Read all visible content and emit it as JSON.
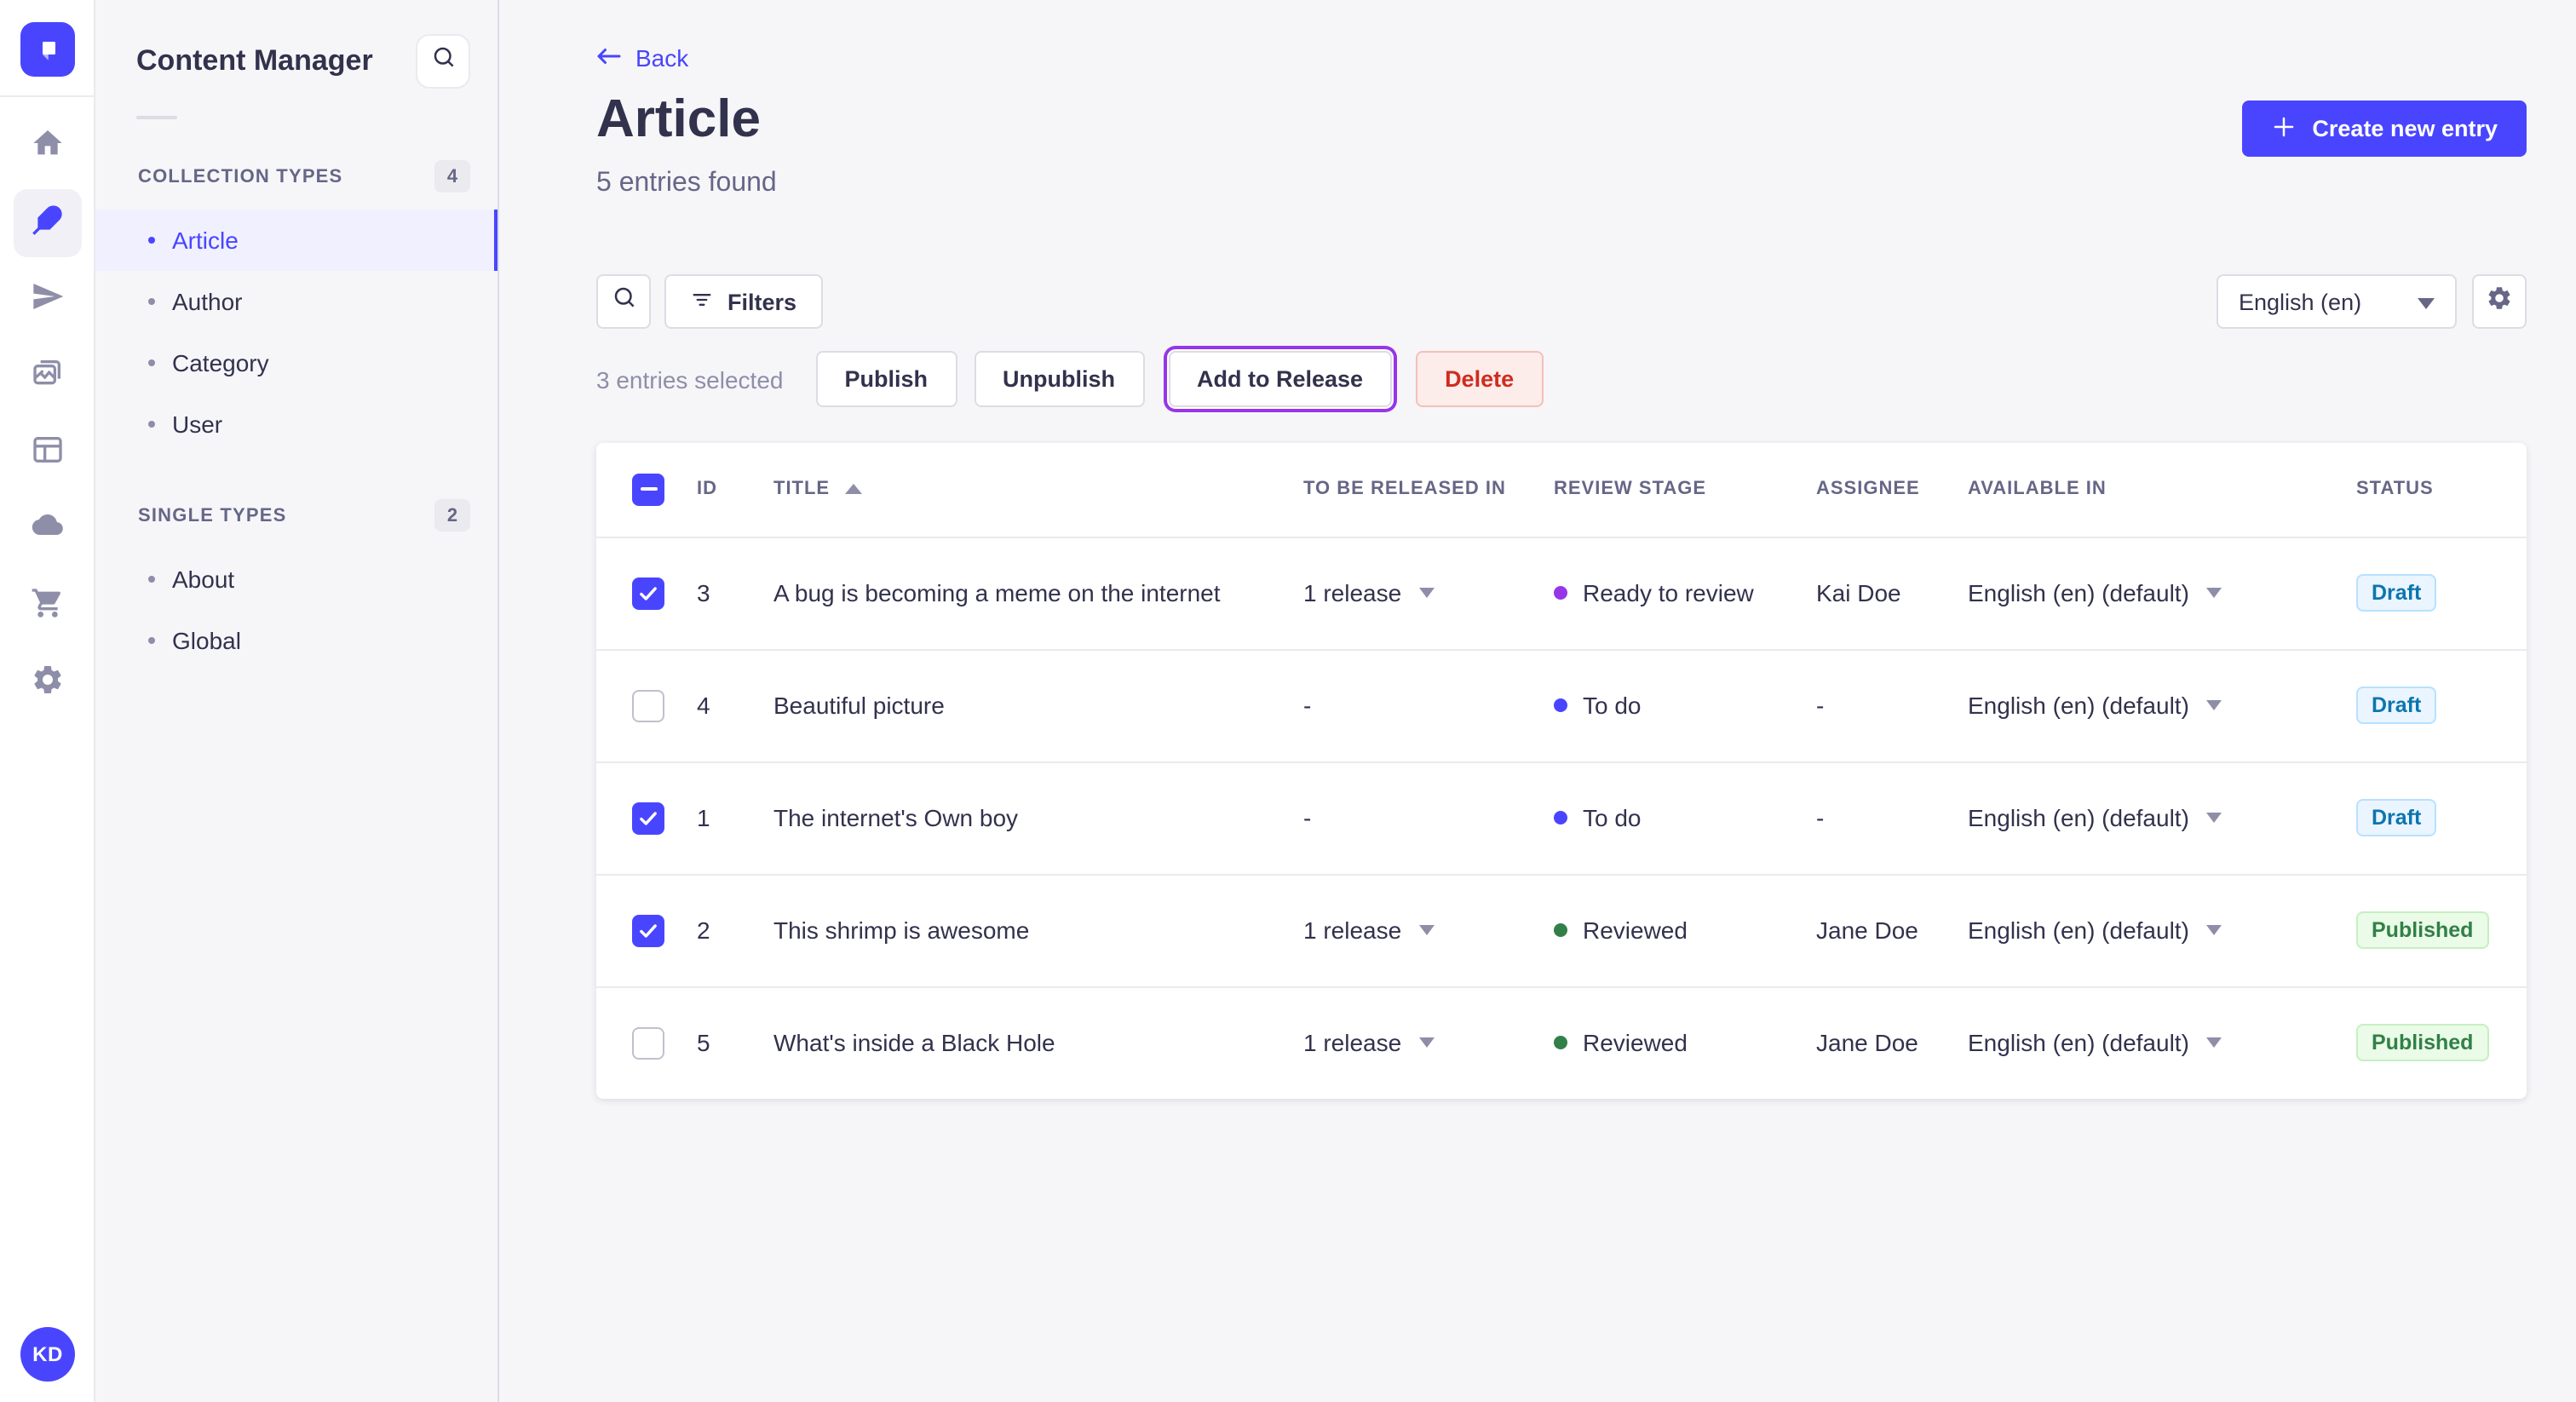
{
  "colors": {
    "primary": "#4945ff",
    "release_focus_ring": "#9736e8",
    "danger_text": "#d02b20",
    "draft_text": "#0c75af",
    "published_text": "#328048"
  },
  "icons": {
    "strapi-logo-icon": "white folded square on indigo",
    "home-icon": "house",
    "feather-icon": "quill pen (content manager, active)",
    "paper-plane-icon": "send / releases",
    "media-library-icon": "stacked photos",
    "layout-icon": "content-type builder panels",
    "cloud-icon": "cloud deploy",
    "cart-icon": "marketplace cart",
    "gear-icon": "settings cog",
    "search-icon": "magnifier",
    "filter-icon": "three funnel lines",
    "chevron-down-icon": "▼",
    "arrow-left-icon": "←",
    "plus-icon": "+",
    "sort-asc-icon": "▲",
    "help-icon": "? in circle"
  },
  "nav": {
    "avatar_initials": "KD",
    "items": [
      {
        "name": "home",
        "active": false
      },
      {
        "name": "content-manager",
        "active": true
      },
      {
        "name": "releases",
        "active": false
      },
      {
        "name": "media-library",
        "active": false
      },
      {
        "name": "content-type-builder",
        "active": false
      },
      {
        "name": "deploy",
        "active": false
      },
      {
        "name": "marketplace",
        "active": false
      },
      {
        "name": "settings",
        "active": false
      }
    ]
  },
  "subnav": {
    "title": "Content Manager",
    "sections": [
      {
        "label": "COLLECTION TYPES",
        "count": "4",
        "items": [
          {
            "label": "Article",
            "active": true
          },
          {
            "label": "Author",
            "active": false
          },
          {
            "label": "Category",
            "active": false
          },
          {
            "label": "User",
            "active": false
          }
        ]
      },
      {
        "label": "SINGLE TYPES",
        "count": "2",
        "items": [
          {
            "label": "About",
            "active": false
          },
          {
            "label": "Global",
            "active": false
          }
        ]
      }
    ]
  },
  "header": {
    "back_label": "Back",
    "title": "Article",
    "subtitle": "5 entries found",
    "create_button_label": "Create new entry"
  },
  "toolbar": {
    "filters_label": "Filters",
    "locale_selected": "English (en)"
  },
  "selection_bar": {
    "selected_text": "3 entries selected",
    "publish_label": "Publish",
    "unpublish_label": "Unpublish",
    "add_to_release_label": "Add to Release",
    "delete_label": "Delete"
  },
  "table": {
    "select_all_state": "indeterminate",
    "columns": [
      {
        "label": "ID",
        "sorted": false
      },
      {
        "label": "TITLE",
        "sorted": "asc"
      },
      {
        "label": "TO BE RELEASED IN",
        "sorted": false
      },
      {
        "label": "REVIEW STAGE",
        "sorted": false
      },
      {
        "label": "ASSIGNEE",
        "sorted": false
      },
      {
        "label": "AVAILABLE IN",
        "sorted": false
      },
      {
        "label": "STATUS",
        "sorted": false
      }
    ],
    "rows": [
      {
        "checked": true,
        "id": "3",
        "title": "A bug is becoming a meme on the internet",
        "release": "1 release",
        "stage": "Ready to review",
        "stage_color": "#9736e8",
        "assignee": "Kai Doe",
        "available": "English (en) (default)",
        "status": "Draft"
      },
      {
        "checked": false,
        "id": "4",
        "title": "Beautiful picture",
        "release": "-",
        "stage": "To do",
        "stage_color": "#4945ff",
        "assignee": "-",
        "available": "English (en) (default)",
        "status": "Draft"
      },
      {
        "checked": true,
        "id": "1",
        "title": "The internet's Own boy",
        "release": "-",
        "stage": "To do",
        "stage_color": "#4945ff",
        "assignee": "-",
        "available": "English (en) (default)",
        "status": "Draft"
      },
      {
        "checked": true,
        "id": "2",
        "title": "This shrimp is awesome",
        "release": "1 release",
        "stage": "Reviewed",
        "stage_color": "#328048",
        "assignee": "Jane Doe",
        "available": "English (en) (default)",
        "status": "Published"
      },
      {
        "checked": false,
        "id": "5",
        "title": "What's inside a Black Hole",
        "release": "1 release",
        "stage": "Reviewed",
        "stage_color": "#328048",
        "assignee": "Jane Doe",
        "available": "English (en) (default)",
        "status": "Published"
      }
    ]
  }
}
